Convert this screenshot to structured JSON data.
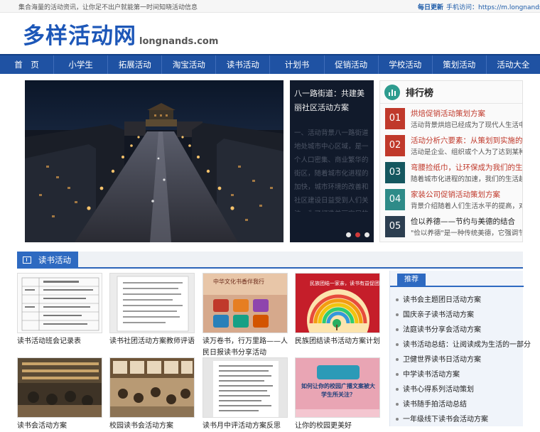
{
  "topbar": {
    "slogan": "集合海量的活动资讯，让你足不出户就能第一时间知晓活动信息",
    "daily": "每日更新",
    "mobile": "手机访问：https://m.longnands.com/"
  },
  "logo": {
    "cn": "多样活动网",
    "en": "longnands.com"
  },
  "nav": [
    "首　页",
    "小学生",
    "拓展活动",
    "淘宝活动",
    "读书活动",
    "计划书",
    "促销活动",
    "学校活动",
    "策划活动",
    "活动大全"
  ],
  "slide": {
    "title": "八一路街道：共建美丽社区活动方案",
    "desc": "一、活动背景八一路街道地处城市中心区域，是一个人口密集、商业繁华的街区，随着城市化进程的加快，城市环境的改善和社区建设日益受到人们关注。为了打造美丽宜居的社区，八一路街道决定开展共建美丽社区活动，号召"
  },
  "rank": {
    "title": "排行榜",
    "colors": {
      "top": "#c0392b",
      "mid": "#15575f",
      "low": "#2c3e50"
    },
    "items": [
      {
        "num": "01",
        "title": "烘焙促销活动策划方案",
        "desc": "活动背景烘焙已经成为了现代人生活中不"
      },
      {
        "num": "02",
        "title": "活动分析六要素：从策划到实施的",
        "desc": "活动是企业、组织或个人为了达到某种目"
      },
      {
        "num": "03",
        "title": "弯腰捡纸巾，让环保成为我们的生",
        "desc": "随着城市化进程的加速，我们的生活越来"
      },
      {
        "num": "04",
        "title": "家装公司促销活动策划方案",
        "desc": "背景介绍随着人们生活水平的提高，对居"
      },
      {
        "num": "05",
        "title": "俭以养德——节约与美德的结合",
        "desc": "\"俭以养德\"是一种传统美德，它强调节"
      }
    ]
  },
  "section": {
    "title": "读书活动",
    "cards": [
      {
        "cap": "读书活动班会记录表"
      },
      {
        "cap": "读书社团活动方案教师评语"
      },
      {
        "cap": "读万卷书，行万里路——人民日报读书分享活动"
      },
      {
        "cap": "民族团结读书活动方案计划"
      },
      {
        "cap": "读书会活动方案"
      },
      {
        "cap": "校园读书会活动方案"
      },
      {
        "cap": "读书月中评活动方案反思"
      },
      {
        "cap": "让你的校园更美好"
      }
    ],
    "thumb_texts": {
      "card3": "中华文化书香伴我行",
      "card4": "民族团结一家亲，读书有益促团结",
      "card8": "如何让你的校园广播文案被大学生所关注？"
    }
  },
  "recommend": {
    "tab": "推荐",
    "items": [
      "读书会主题团日活动方案",
      "国庆亲子读书活动方案",
      "法庭读书分享会活动方案",
      "读书活动总结：让阅读成为生活的一部分",
      "卫健世界读书日活动方案",
      "中学读书活动方案",
      "读书心得系列活动策划",
      "读书随手拍活动总结",
      "一年级线下读书会活动方案"
    ]
  }
}
